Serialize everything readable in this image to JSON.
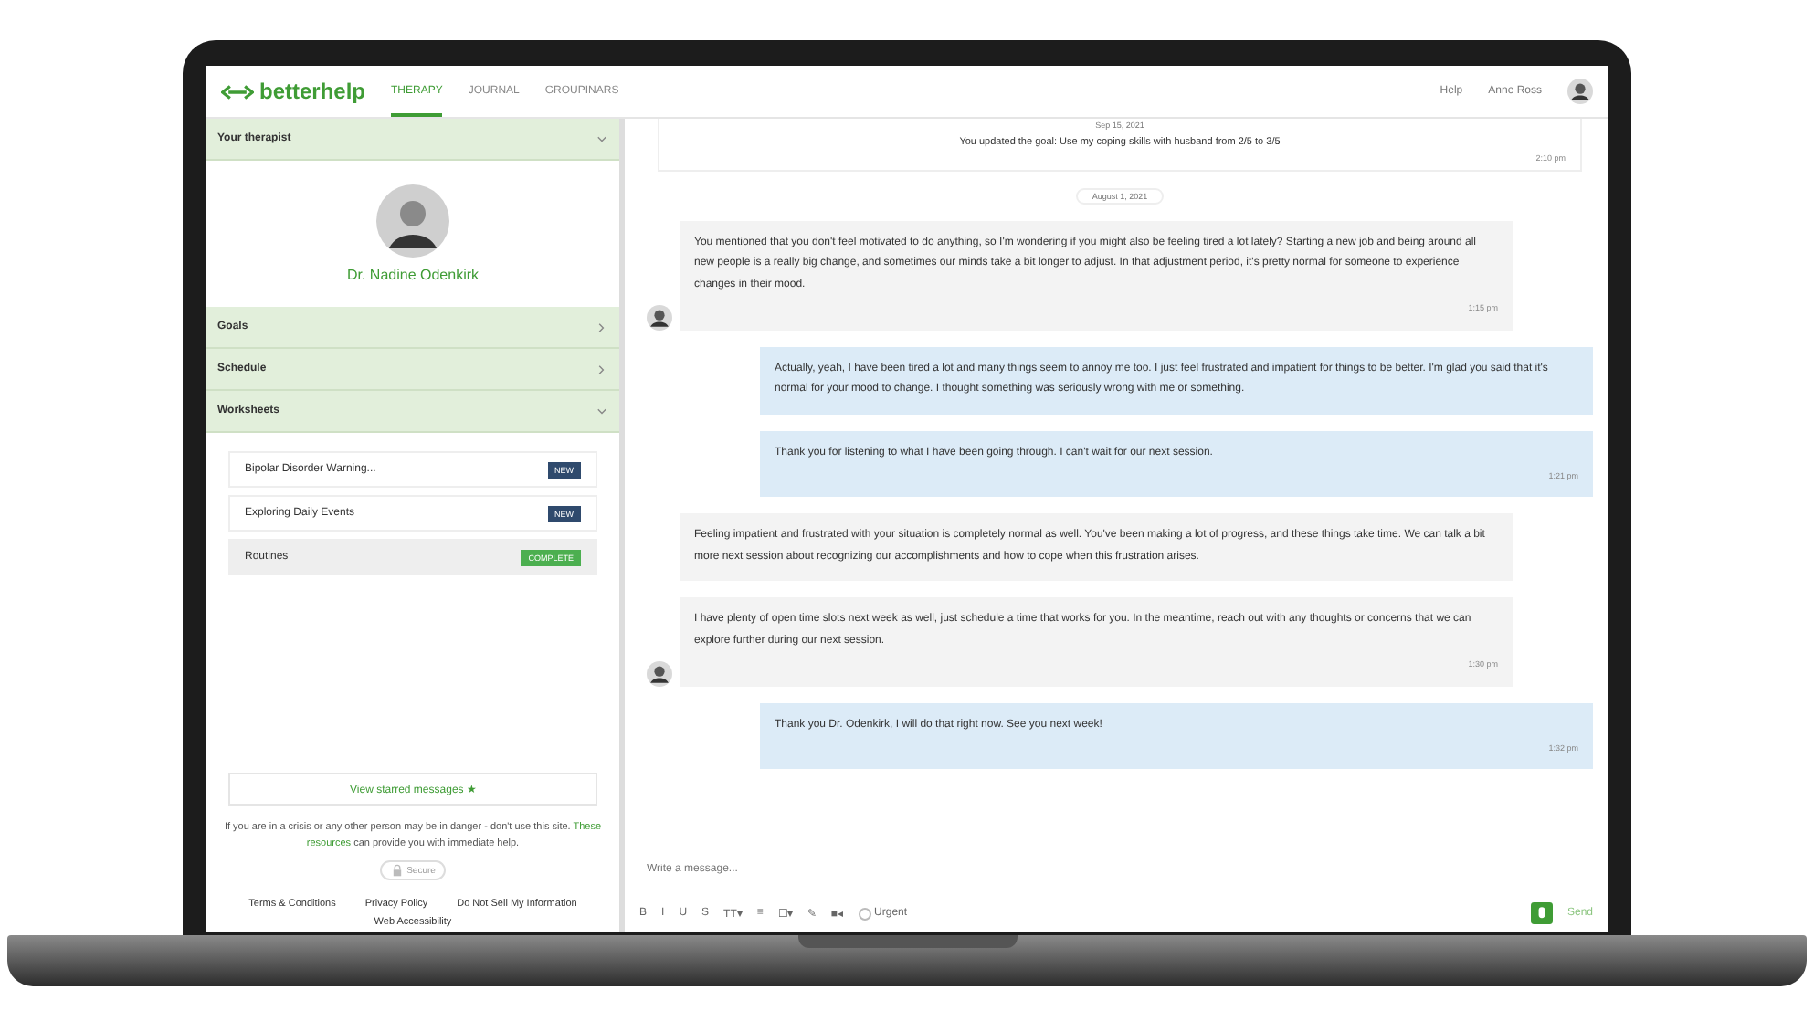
{
  "header": {
    "logo": "betterhelp",
    "tabs": [
      {
        "label": "THERAPY",
        "selected": true
      },
      {
        "label": "JOURNAL",
        "selected": false
      },
      {
        "label": "GROUPINARS",
        "selected": false
      }
    ],
    "help": "Help",
    "user": "Anne Ross"
  },
  "sidebar": {
    "sections": [
      {
        "title": "Your therapist",
        "expanded": true,
        "kind": "therapist",
        "therapist_name": "Dr. Nadine Odenkirk"
      },
      {
        "title": "Goals",
        "expanded": false
      },
      {
        "title": "Schedule",
        "expanded": false
      },
      {
        "title": "Worksheets",
        "expanded": true,
        "kind": "worksheets",
        "items": [
          {
            "title": "Bipolar Disorder Warning...",
            "badge": "NEW",
            "kind": "new",
            "selected": false
          },
          {
            "title": "Exploring Daily Events",
            "badge": "NEW",
            "kind": "new",
            "selected": false
          },
          {
            "title": "Routines",
            "badge": "COMPLETE",
            "kind": "complete",
            "selected": true
          }
        ]
      }
    ],
    "starred": "View starred messages ★",
    "crisis": "If you are in a crisis or any other person may be in danger - don't use this site. **These resources** can provide you with immediate help.",
    "secure": "Secure",
    "links": [
      "Terms & Conditions",
      "Privacy Policy",
      "Do Not Sell My Information",
      "Web Accessibility"
    ]
  },
  "chat": {
    "items": [
      {
        "kind": "goal",
        "date": "Sep 15, 2021",
        "text": "You updated the goal: Use my coping skills with husband from 2/5 to 3/5",
        "time": "2:10 pm"
      },
      {
        "kind": "date",
        "text": "August 1, 2021"
      },
      {
        "kind": "therapist_message",
        "avatar": true,
        "text": "You mentioned that you don't feel motivated to do anything, so I'm wondering if you might also be feeling tired a lot lately? Starting a new job and being around all new people is a really big change, and sometimes our minds take a bit longer to adjust. In that adjustment period, it's pretty normal for someone to experience changes in their mood.",
        "time": "1:15 pm"
      },
      {
        "kind": "client_message",
        "text": "Actually, yeah, I have been tired a lot and many things seem to annoy me too. I just feel frustrated and impatient for things to be better. I'm glad you said that it's normal for your mood to change. I thought something was seriously wrong with me or something."
      },
      {
        "kind": "client_message",
        "text": "Thank you for listening to what I have been going through. I can't wait for our next session.",
        "time": "1:21 pm"
      },
      {
        "kind": "therapist_message",
        "avatar": false,
        "text": "Feeling impatient and frustrated with your situation is completely normal as well. You've been making a lot of progress, and these things take time. We can talk a bit more next session about recognizing our accomplishments and how to cope when this frustration arises."
      },
      {
        "kind": "therapist_message",
        "avatar": true,
        "text": "I have plenty of open time slots next week as well, just schedule a time that works for you. In the meantime, reach out with any thoughts or concerns that we can explore further during our next session.",
        "time": "1:30 pm"
      },
      {
        "kind": "client_message",
        "text": "Thank you Dr. Odenkirk, I will do that right now. See you next week!",
        "time": "1:32 pm"
      }
    ],
    "composer": {
      "placeholder": "Write a message...",
      "tools": [
        "B",
        "I",
        "U",
        "S",
        "TT▾",
        "≡",
        "☐▾",
        "✎",
        "■◂"
      ],
      "urgent": {
        "label": "Urgent",
        "checked": false
      },
      "send": "Send"
    }
  }
}
